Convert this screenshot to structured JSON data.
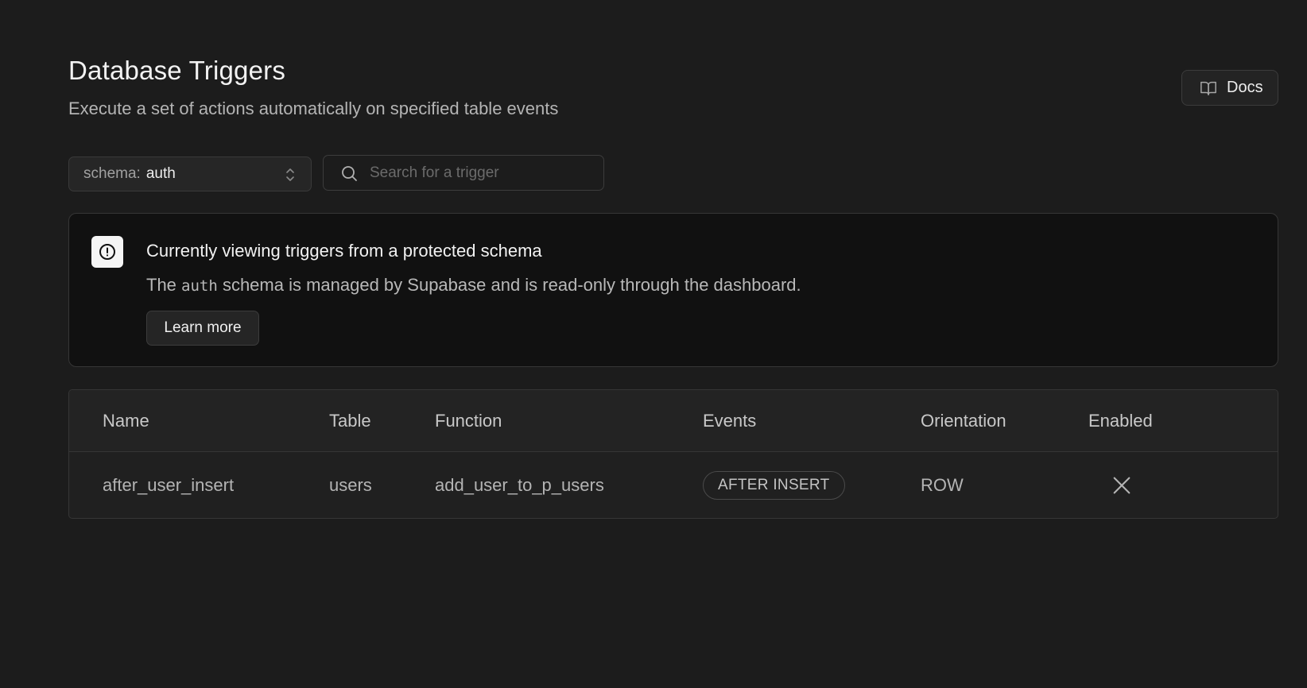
{
  "header": {
    "title": "Database Triggers",
    "subtitle": "Execute a set of actions automatically on specified table events",
    "docs_label": "Docs"
  },
  "filters": {
    "schema_prefix": "schema:",
    "schema_value": "auth",
    "search_placeholder": "Search for a trigger",
    "search_value": ""
  },
  "alert": {
    "title": "Currently viewing triggers from a protected schema",
    "desc_before": "The",
    "desc_code": "auth",
    "desc_after": "schema is managed by Supabase and is read-only through the dashboard.",
    "button_label": "Learn more"
  },
  "table": {
    "columns": [
      "Name",
      "Table",
      "Function",
      "Events",
      "Orientation",
      "Enabled"
    ],
    "rows": [
      {
        "name": "after_user_insert",
        "table": "users",
        "function": "add_user_to_p_users",
        "events": "AFTER INSERT",
        "orientation": "ROW",
        "enabled": false
      }
    ]
  },
  "icons": {
    "docs": "book-open-icon",
    "schema_chevron": "chevrons-up-down-icon",
    "search": "search-icon",
    "alert": "alert-circle-icon",
    "enabled_false": "x-icon"
  }
}
